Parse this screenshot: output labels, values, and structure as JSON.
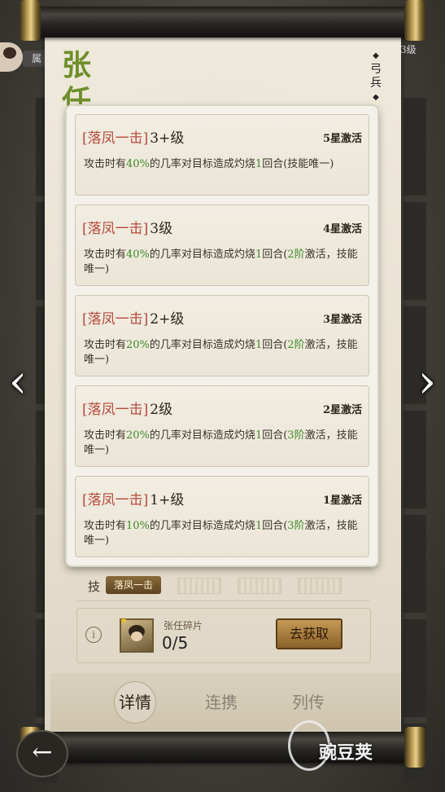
{
  "hero": {
    "name": "张任",
    "class_label": "弓兵"
  },
  "left_badge": "属",
  "right_level": "3级",
  "skill_levels": [
    {
      "bracket_name": "[落凤一击]",
      "level": "3+级",
      "star": "5星激活",
      "desc_parts": [
        "攻击时有",
        "40%",
        "的几率对目标造成灼烧",
        "1",
        "回合(技能唯一)"
      ]
    },
    {
      "bracket_name": "[落凤一击]",
      "level": "3级",
      "star": "4星激活",
      "desc_parts": [
        "攻击时有",
        "40%",
        "的几率对目标造成灼烧",
        "1",
        "回合(",
        "2阶",
        "激活，技能唯一)"
      ]
    },
    {
      "bracket_name": "[落凤一击]",
      "level": "2+级",
      "star": "3星激活",
      "desc_parts": [
        "攻击时有",
        "20%",
        "的几率对目标造成灼烧",
        "1",
        "回合(",
        "2阶",
        "激活，技能唯一)"
      ]
    },
    {
      "bracket_name": "[落凤一击]",
      "level": "2级",
      "star": "2星激活",
      "desc_parts": [
        "攻击时有",
        "20%",
        "的几率对目标造成灼烧",
        "1",
        "回合(",
        "3阶",
        "激活，技能唯一)"
      ]
    },
    {
      "bracket_name": "[落凤一击]",
      "level": "1+级",
      "star": "1星激活",
      "desc_parts": [
        "攻击时有",
        "10%",
        "的几率对目标造成灼烧",
        "1",
        "回合(",
        "3阶",
        "激活，技能唯一)"
      ]
    }
  ],
  "skill_bar": {
    "label": "技",
    "skill_name": "落凤一击"
  },
  "fragment": {
    "name": "张任碎片",
    "count": "0/5",
    "get_label": "去获取"
  },
  "tabs": [
    {
      "label": "详情"
    },
    {
      "label": "连携"
    },
    {
      "label": "列传"
    }
  ],
  "watermark": "豌豆荚",
  "colors": {
    "accent_green": "#3f8a2a",
    "skill_red": "#b44b3d",
    "name_green": "#6e8f2b"
  }
}
